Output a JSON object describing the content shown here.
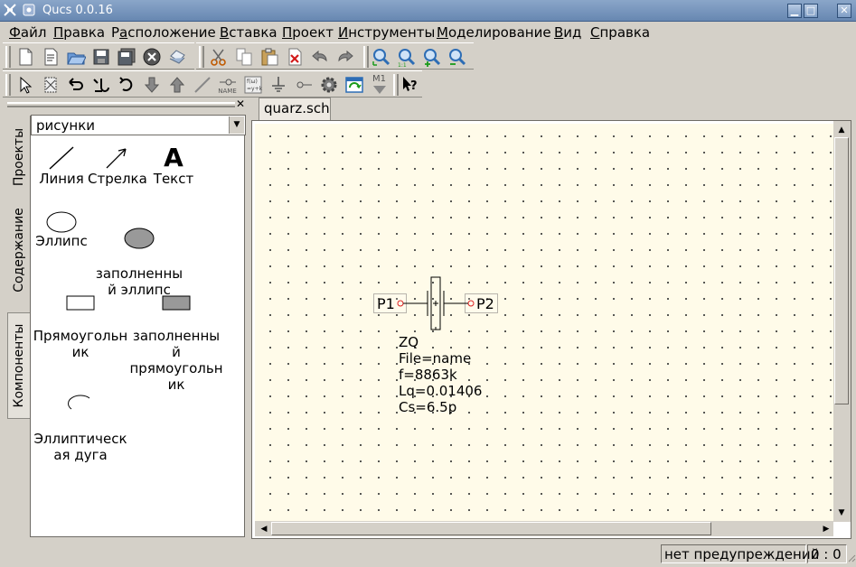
{
  "window": {
    "title": "Qucs 0.0.16",
    "min_glyph": "▁",
    "max_glyph": "□",
    "close_glyph": "✕"
  },
  "menu": [
    {
      "label_u": "Ф",
      "label_rest": "айл"
    },
    {
      "label_u": "П",
      "label_rest": "равка"
    },
    {
      "label_pre": "Р",
      "label_u": "а",
      "label_rest": "сположение"
    },
    {
      "label_u": "В",
      "label_rest": "ставка"
    },
    {
      "label_u": "П",
      "label_rest": "роект"
    },
    {
      "label_u": "И",
      "label_rest": "нструменты"
    },
    {
      "label_u": "М",
      "label_rest": "оделирование"
    },
    {
      "label_u": "В",
      "label_rest": "ид"
    },
    {
      "label_u": "С",
      "label_rest": "правка"
    }
  ],
  "toolbar2": {
    "name_label": "NAME",
    "m1_label": "M1"
  },
  "dock": {
    "tabs": [
      "Проекты",
      "Содержание",
      "Компоненты"
    ],
    "category": "рисунки",
    "components": [
      {
        "label": "Линия"
      },
      {
        "label": "Стрелка"
      },
      {
        "label": "Текст",
        "glyph": "A"
      },
      {
        "label": "Эллипс"
      },
      {
        "label": "заполненны\nй эллипс"
      },
      {
        "label": "Прямоугольн\nик"
      },
      {
        "label": "заполненны\nй\nпрямоугольн\nик"
      },
      {
        "label": "Эллиптическ\nая дуга"
      }
    ]
  },
  "document": {
    "tab": "quarz.sch",
    "ports": {
      "p1": "P1",
      "p2": "P2"
    },
    "component": {
      "name": "ZQ",
      "file": "File=name",
      "freq": "f=8863k",
      "lq": "Lq=0.01406",
      "cs": "Cs=6.5p"
    }
  },
  "status": {
    "warnings": "нет предупреждений",
    "position": "0 : 0"
  }
}
